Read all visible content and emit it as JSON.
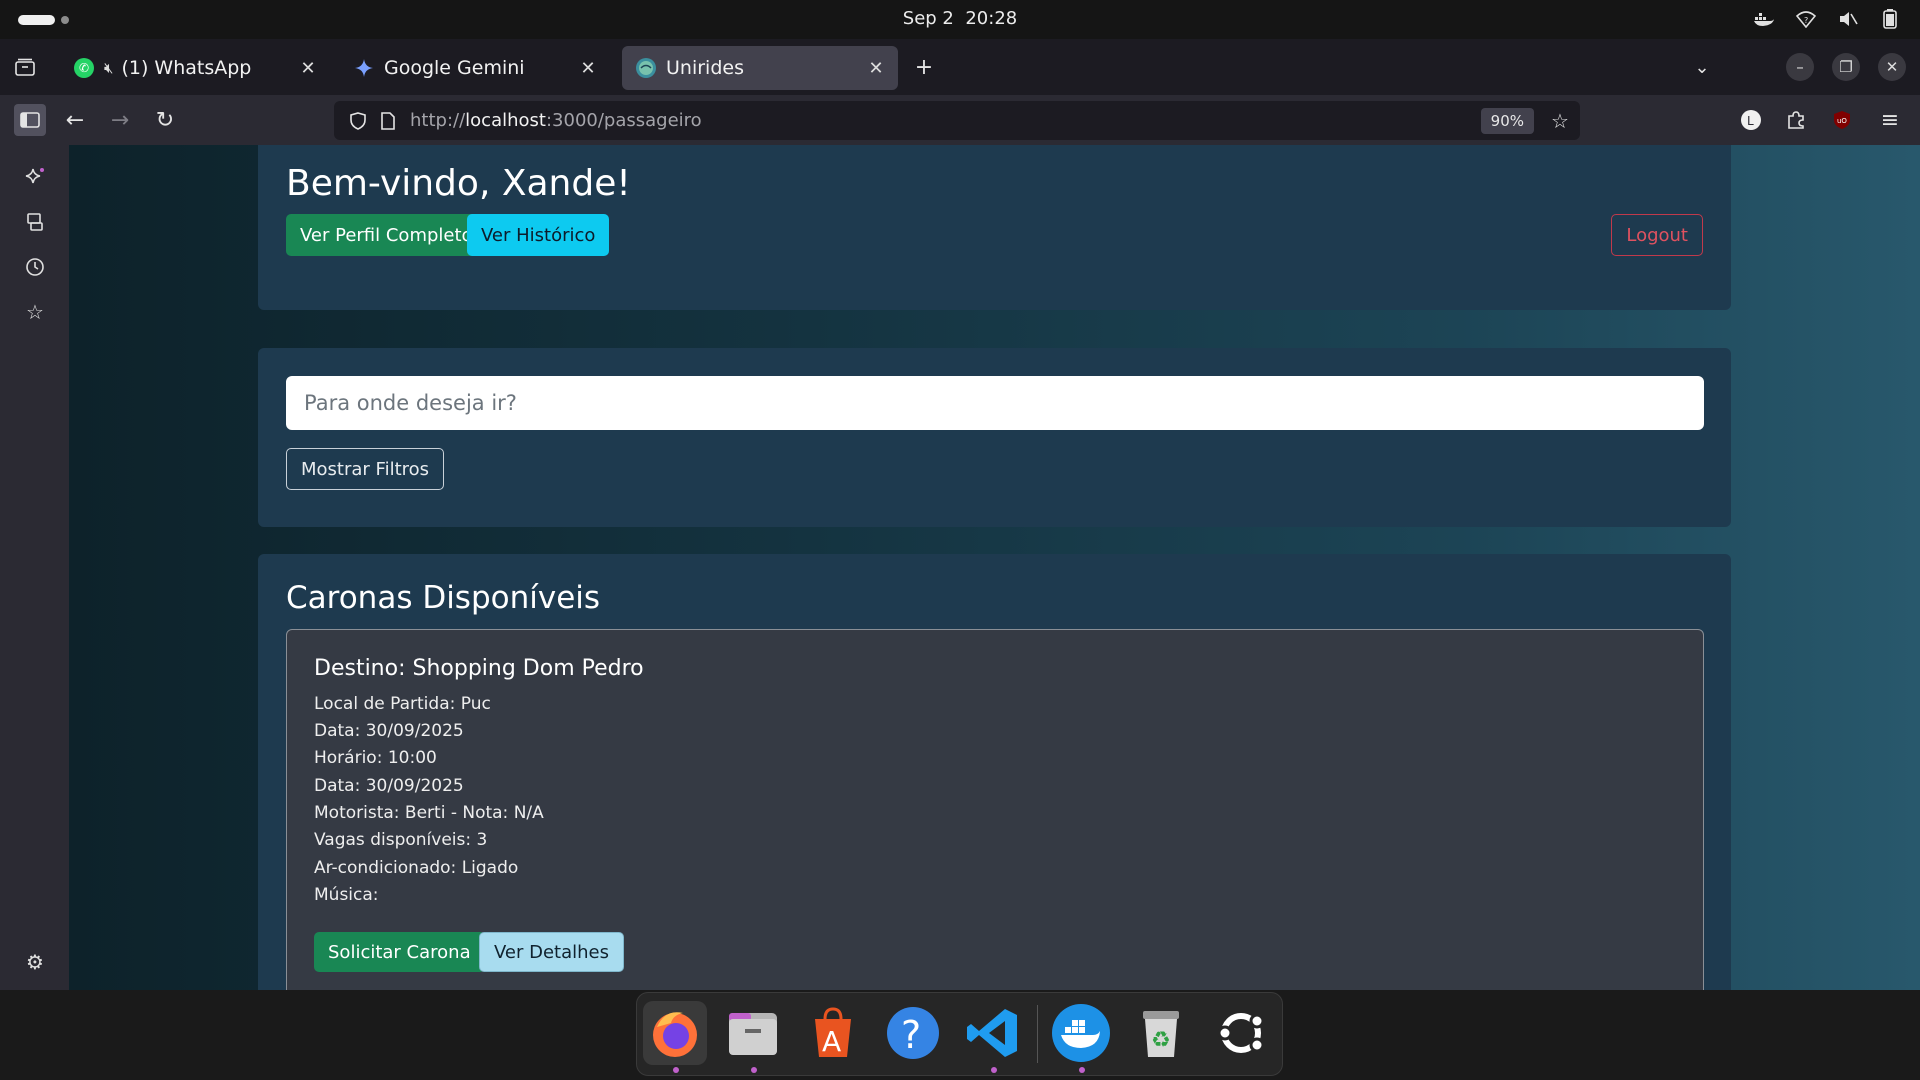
{
  "system": {
    "date": "Sep 2",
    "time": "20:28"
  },
  "tabs": [
    {
      "title": "(1) WhatsApp",
      "muted": true
    },
    {
      "title": "Google Gemini"
    },
    {
      "title": "Unirides",
      "active": true
    }
  ],
  "nav": {
    "url_prefix": "http://",
    "url_host": "localhost",
    "url_path": ":3000/passageiro",
    "zoom": "90%"
  },
  "header_card": {
    "welcome": "Bem-vindo, Xande!",
    "profile_button": "Ver Perfil Completo",
    "history_button": "Ver Histórico",
    "logout_button": "Logout"
  },
  "search_card": {
    "placeholder": "Para onde deseja ir?",
    "filters_button": "Mostrar Filtros"
  },
  "rides": {
    "title": "Caronas Disponíveis",
    "items": [
      {
        "destination": "Destino: Shopping Dom Pedro",
        "lines": [
          "Local de Partida: Puc",
          "Data: 30/09/2025",
          "Horário: 10:00",
          "Data: 30/09/2025",
          "Motorista: Berti - Nota: N/A",
          "Vagas disponíveis: 3",
          "Ar-condicionado: Ligado",
          "Música:"
        ],
        "request_button": "Solicitar Carona",
        "details_button": "Ver Detalhes"
      }
    ]
  },
  "colors": {
    "accent_green": "#198754",
    "accent_cyan": "#0dcaf0",
    "logout_red": "#e05260",
    "card_bg": "#1e3a4f"
  },
  "dock_apps": [
    "firefox-icon",
    "files-icon",
    "app-center-icon",
    "help-icon",
    "vscode-icon",
    "docker-icon",
    "trash-icon",
    "ubuntu-icon"
  ]
}
